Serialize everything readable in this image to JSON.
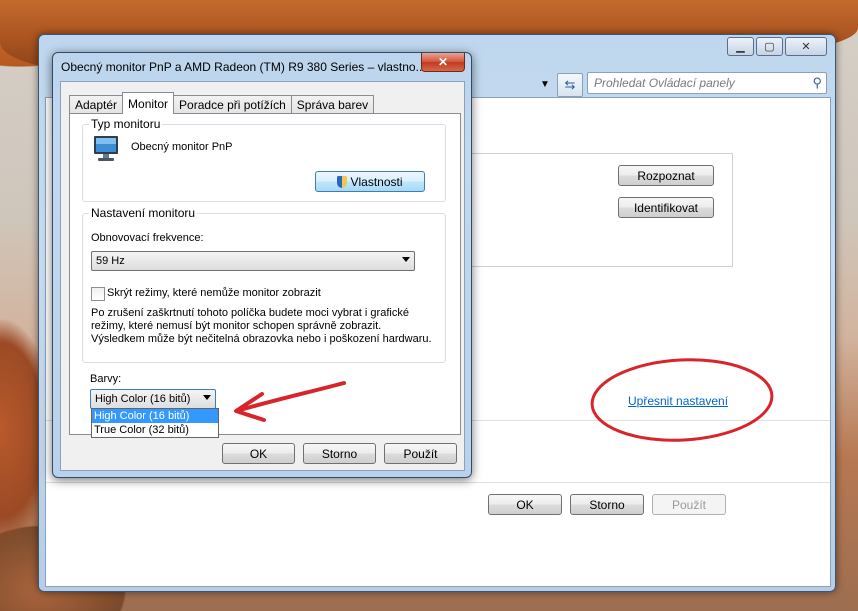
{
  "background_window": {
    "search_placeholder": "Prohledat Ovládací panely",
    "detect_button": "Rozpoznat",
    "identify_button": "Identifikovat",
    "advanced_link": "Upřesnit nastavení",
    "ok": "OK",
    "cancel": "Storno",
    "apply": "Použít",
    "minimize_glyph": "▁",
    "maximize_glyph": "▢",
    "close_glyph": "✕"
  },
  "dialog": {
    "title": "Obecný monitor PnP a AMD Radeon (TM) R9 380 Series – vlastno...",
    "close_glyph": "✕",
    "tabs": [
      "Adaptér",
      "Monitor",
      "Poradce při potížích",
      "Správa barev"
    ],
    "active_tab": "Monitor",
    "monitor_type_label": "Typ monitoru",
    "monitor_name": "Obecný monitor PnP",
    "properties_button": "Vlastnosti",
    "monitor_settings_label": "Nastavení monitoru",
    "refresh_rate_label": "Obnovovací frekvence:",
    "refresh_rate_value": "59 Hz",
    "hide_modes_label": "Skrýt režimy, které nemůže monitor zobrazit",
    "hide_modes_checked": false,
    "warning_lines": [
      "Po zrušení zaškrtnutí tohoto políčka budete moci vybrat i grafické",
      "režimy, které nemusí být monitor schopen správně zobrazit.",
      "Výsledkem může být nečitelná obrazovka nebo i poškození hardwaru."
    ],
    "colors_label": "Barvy:",
    "colors_value": "High Color (16 bitů)",
    "colors_options": [
      "High Color (16 bitů)",
      "True Color (32 bitů)"
    ],
    "ok": "OK",
    "cancel": "Storno",
    "apply": "Použít"
  },
  "annotations": {
    "arrow_color": "#d9242b",
    "circle_color": "#d9242b"
  }
}
